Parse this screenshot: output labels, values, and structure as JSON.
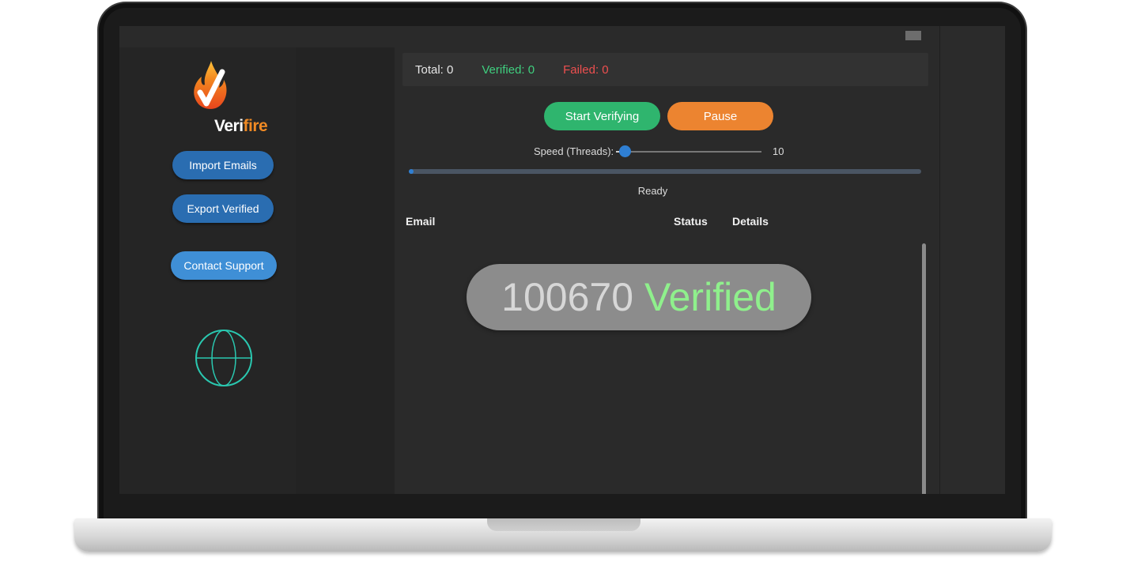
{
  "window": {
    "control_icon": "window-control-icon"
  },
  "sidebar": {
    "logo_text_main": "Veri",
    "logo_text_accent": "fire",
    "logo_icon": "flame-checkmark-icon",
    "buttons": {
      "import": "Import Emails",
      "export": "Export Verified",
      "support": "Contact Support"
    },
    "globe_icon": "globe-icon"
  },
  "stats": {
    "total": "Total: 0",
    "verified": "Verified: 0",
    "failed": "Failed: 0"
  },
  "controls": {
    "start": "Start Verifying",
    "pause": "Pause",
    "speed_label": "Speed (Threads):",
    "speed_value": "10",
    "speed_fraction": 0.06
  },
  "progress": {
    "fraction": 0.0,
    "status": "Ready"
  },
  "table": {
    "columns": [
      "Email",
      "Status",
      "Details"
    ],
    "rows": []
  },
  "overlay": {
    "count": "100670",
    "label": "Verified"
  },
  "colors": {
    "accent_blue": "#2a6db1",
    "start_green": "#2fb56e",
    "pause_orange": "#ec8430",
    "verified_green": "#3fcf7f",
    "failed_red": "#ee4f4f",
    "brand_orange": "#f08a24"
  }
}
